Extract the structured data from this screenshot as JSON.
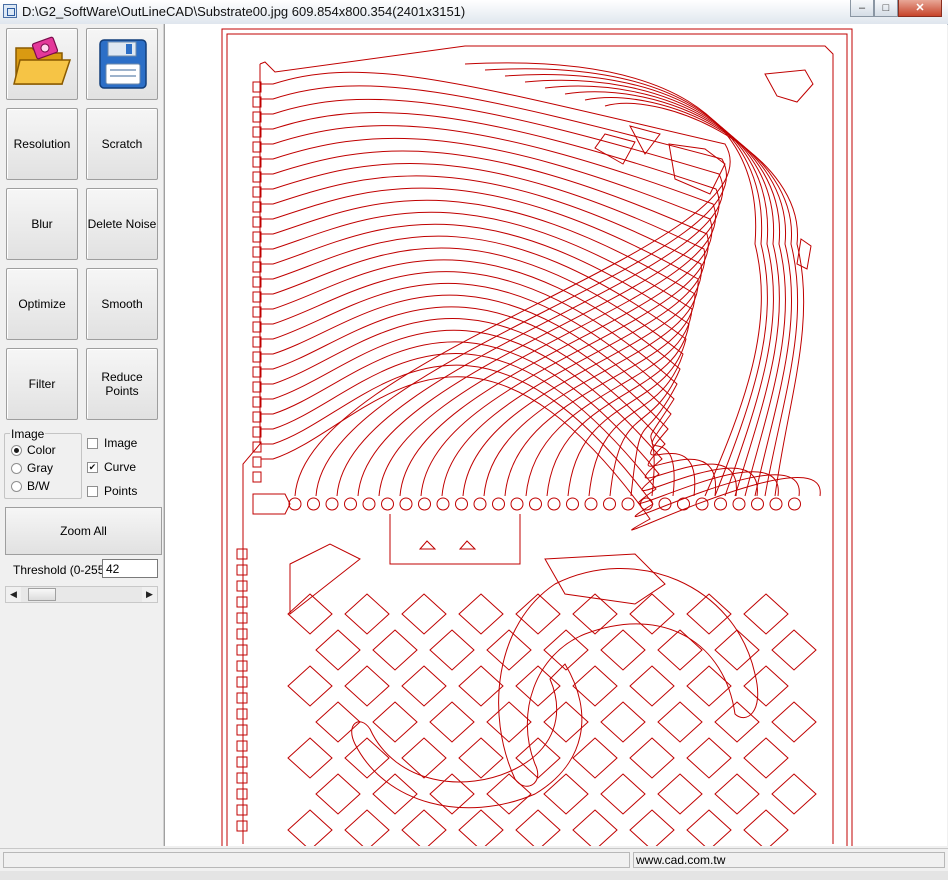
{
  "window": {
    "title": "D:\\G2_SoftWare\\OutLineCAD\\Substrate00.jpg 609.854x800.354(2401x3151)",
    "minimize": "–",
    "maximize": "□",
    "close": "✕"
  },
  "toolbar": {
    "open_icon": "folder-open-icon",
    "save_icon": "floppy-save-icon",
    "buttons": [
      {
        "label": "Resolution"
      },
      {
        "label": "Scratch"
      },
      {
        "label": "Blur"
      },
      {
        "label": "Delete Noise"
      },
      {
        "label": "Optimize"
      },
      {
        "label": "Smooth"
      },
      {
        "label": "Filter"
      },
      {
        "label": "Reduce Points"
      }
    ]
  },
  "image_mode": {
    "group_label": "Image",
    "options": [
      {
        "label": "Color",
        "selected": true
      },
      {
        "label": "Gray",
        "selected": false
      },
      {
        "label": "B/W",
        "selected": false
      }
    ]
  },
  "layers": [
    {
      "label": "Image",
      "checked": false
    },
    {
      "label": "Curve",
      "checked": true
    },
    {
      "label": "Points",
      "checked": false
    }
  ],
  "zoom_all_label": "Zoom All",
  "threshold": {
    "label": "Threshold (0-255)",
    "value": "42"
  },
  "status": {
    "left": "",
    "url": "www.cad.com.tw"
  },
  "colors": {
    "curve": "#c00000"
  }
}
